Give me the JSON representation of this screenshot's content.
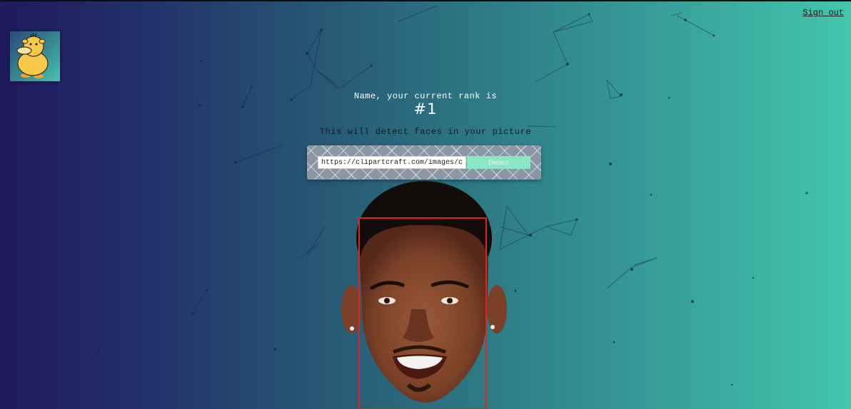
{
  "header": {
    "signout_label": "Sign out"
  },
  "logo": {
    "icon": "duck-icon"
  },
  "rank": {
    "title": "Name, your current rank is",
    "value": "#1"
  },
  "description": "This will detect faces in your picture",
  "form": {
    "url_value": "https://clipartcraft.com/images/cele",
    "detect_label": "Detect"
  },
  "result": {
    "image_subject": "face-photo",
    "box_color": "#e52020"
  },
  "colors": {
    "gradient_start": "#1f1a5c",
    "gradient_end": "#43c6ac",
    "detect_button": "#8ae6c5"
  }
}
